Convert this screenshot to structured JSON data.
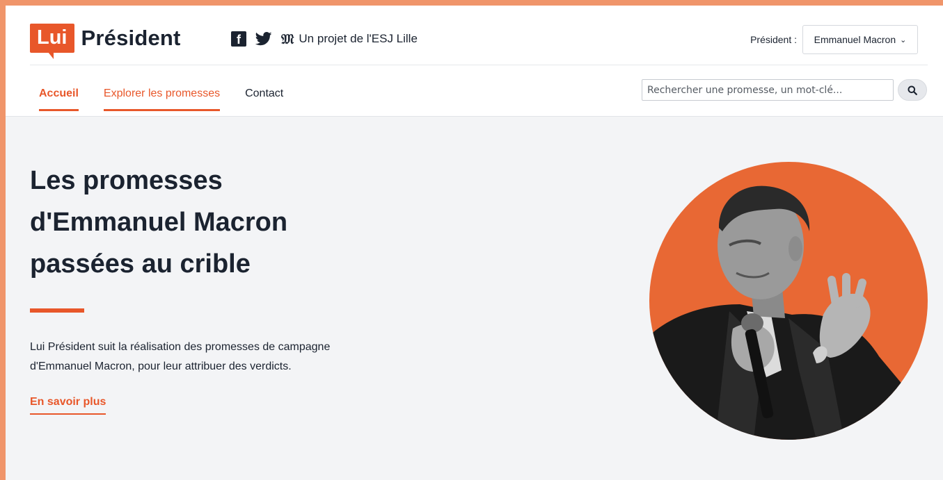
{
  "brand": {
    "badge": "Lui",
    "word": "Président"
  },
  "header": {
    "project_text": "Un projet de l'ESJ Lille",
    "icons": [
      "facebook-icon",
      "twitter-icon",
      "le-monde-icon"
    ],
    "president_label": "Président :",
    "president_selected": "Emmanuel Macron"
  },
  "nav": {
    "items": [
      {
        "label": "Accueil"
      },
      {
        "label": "Explorer les promesses"
      },
      {
        "label": "Contact"
      }
    ]
  },
  "search": {
    "placeholder": "Rechercher une promesse, un mot-clé..."
  },
  "hero": {
    "title_lines": [
      "Les promesses",
      "d'Emmanuel Macron",
      "passées au crible"
    ],
    "description_lines": [
      "Lui Président suit la réalisation des promesses de campagne",
      "d'Emmanuel Macron, pour leur attribuer des verdicts."
    ],
    "link": "En savoir plus"
  },
  "colors": {
    "accent": "#e8572a",
    "text": "#1b2330",
    "background": "#f3f4f6",
    "frame": "#f0956a"
  }
}
